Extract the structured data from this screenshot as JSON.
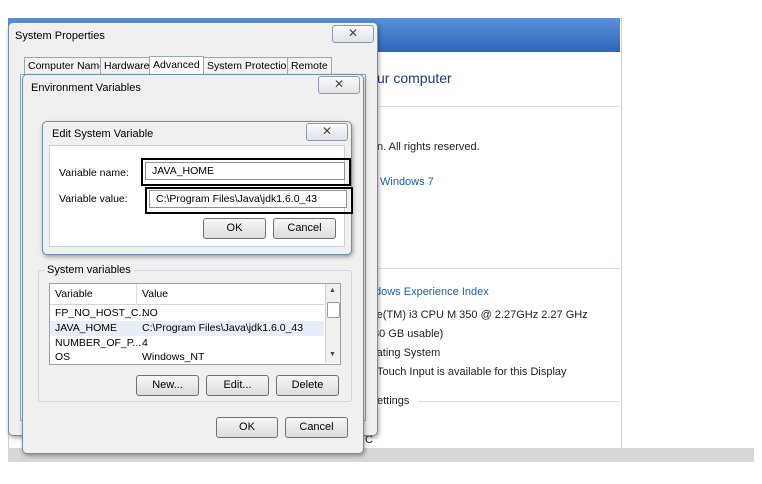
{
  "background": {
    "heading": "ur computer",
    "rights": "n.  All rights reserved.",
    "edition": "Windows 7",
    "experience_index": "dows Experience Index",
    "processor": "re(TM) i3 CPU       M 350  @ 2.27GHz   2.27 GHz",
    "memory": "30 GB usable)",
    "system_type": "rating System",
    "touch": "Touch Input is available for this Display",
    "settings": "ettings",
    "stray_char": "C"
  },
  "system_properties": {
    "title": "System Properties",
    "close_glyph": "✕",
    "tabs": [
      "Computer Name",
      "Hardware",
      "Advanced",
      "System Protection",
      "Remote"
    ],
    "active_tab": "Advanced"
  },
  "env_vars": {
    "title": "Environment Variables",
    "close_glyph": "✕",
    "system_vars_label": "System variables",
    "columns": [
      "Variable",
      "Value"
    ],
    "rows": [
      {
        "variable": "FP_NO_HOST_C...",
        "value": "NO"
      },
      {
        "variable": "JAVA_HOME",
        "value": "C:\\Program Files\\Java\\jdk1.6.0_43"
      },
      {
        "variable": "NUMBER_OF_P...",
        "value": "4"
      },
      {
        "variable": "OS",
        "value": "Windows_NT"
      }
    ],
    "new_label": "New...",
    "edit_label": "Edit...",
    "delete_label": "Delete",
    "ok_label": "OK",
    "cancel_label": "Cancel"
  },
  "edit_var": {
    "title": "Edit System Variable",
    "close_glyph": "✕",
    "name_label": "Variable name:",
    "name_value": "JAVA_HOME",
    "value_label": "Variable value:",
    "value_value": "C:\\Program Files\\Java\\jdk1.6.0_43",
    "ok_label": "OK",
    "cancel_label": "Cancel"
  },
  "colors": {
    "titlebar": "#2f66b8",
    "link": "#1a5fb4",
    "dialog_bg": "#f0f0f0"
  }
}
